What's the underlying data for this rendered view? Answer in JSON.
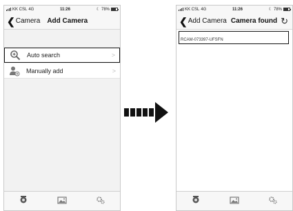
{
  "left_screen": {
    "status": {
      "carrier": "KK CSL",
      "network": "4G",
      "time": "11:26",
      "battery": "78%",
      "battery_level": 0.78
    },
    "nav": {
      "back_label": "Camera",
      "title": "Add Camera"
    },
    "rows": [
      {
        "label": "Auto search",
        "icon": "magnifier-plus-icon",
        "chevron": ">"
      },
      {
        "label": "Manually add",
        "icon": "person-add-icon",
        "chevron": ">"
      }
    ],
    "tabs": [
      {
        "icon": "camera-icon"
      },
      {
        "icon": "gallery-icon"
      },
      {
        "icon": "settings-gears-icon"
      }
    ]
  },
  "right_screen": {
    "status": {
      "carrier": "KK CSL",
      "network": "4G",
      "time": "11:26",
      "battery": "78%",
      "battery_level": 0.78
    },
    "nav": {
      "back_label": "Add Camera",
      "title": "Camera found",
      "refresh_icon": "refresh-icon"
    },
    "found_cameras": [
      {
        "id": "RCAM-073397-UFSFN"
      }
    ],
    "tabs": [
      {
        "icon": "camera-icon"
      },
      {
        "icon": "gallery-icon"
      },
      {
        "icon": "settings-gears-icon"
      }
    ]
  },
  "transition_arrow": {
    "icon": "arrow-right-icon",
    "color": "#111111"
  }
}
